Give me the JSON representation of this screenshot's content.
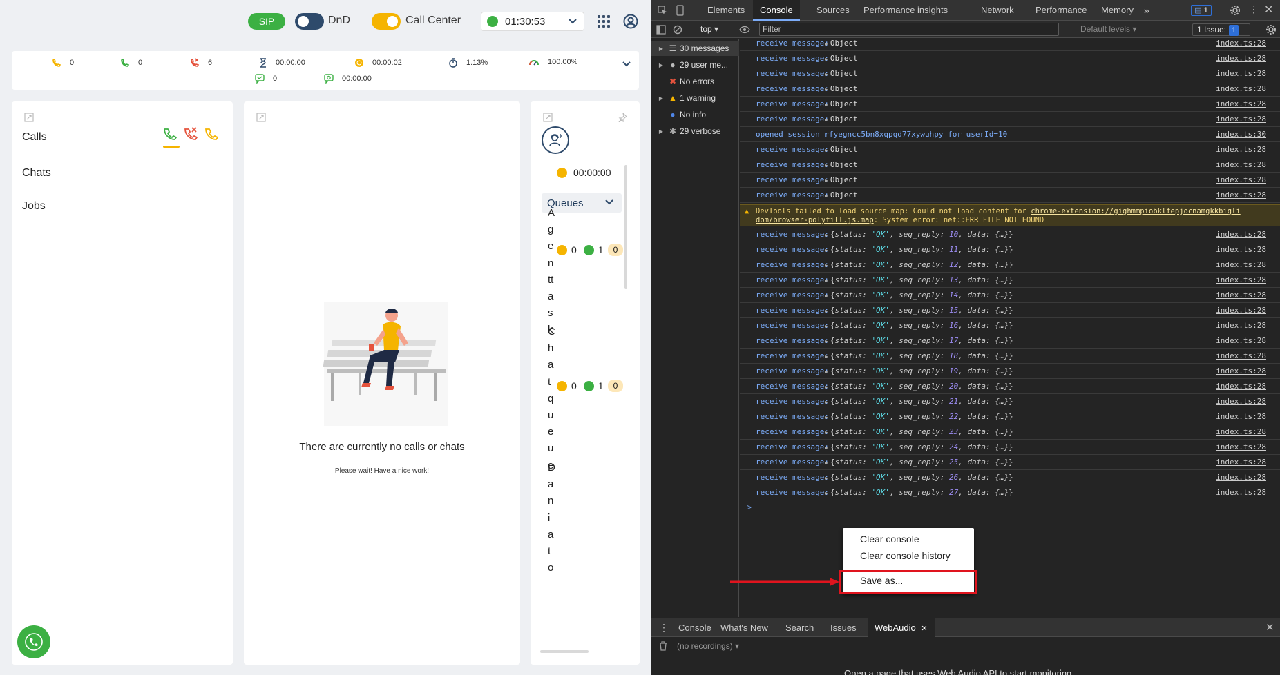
{
  "app": {
    "topbar": {
      "sip_label": "SIP",
      "dnd_label": "DnD",
      "call_center_label": "Call Center",
      "status_timer": "01:30:53"
    },
    "stats": [
      {
        "icon": "incoming-call-icon",
        "value": "0",
        "color": "#f5b400"
      },
      {
        "icon": "outgoing-call-icon",
        "value": "0",
        "color": "#3cb043"
      },
      {
        "icon": "missed-call-icon",
        "value": "6",
        "color": "#e5533d"
      },
      {
        "icon": "hourglass-icon",
        "value": "00:00:00",
        "color": "#2e4a6b"
      },
      {
        "icon": "coin-icon",
        "value": "00:00:02",
        "color": "#f5b400"
      },
      {
        "icon": "stopwatch-icon",
        "value": "1.13%",
        "color": "#2e4a6b"
      },
      {
        "icon": "gauge-icon",
        "value": "100.00%",
        "color": "#e5533d"
      },
      {
        "icon": "chat-check-icon",
        "value": "0",
        "color": "#3cb043"
      },
      {
        "icon": "chat-time-icon",
        "value": "00:00:00",
        "color": "#3cb043"
      }
    ],
    "nav": {
      "calls": "Calls",
      "chats": "Chats",
      "jobs": "Jobs"
    },
    "empty": {
      "title": "There are currently no calls or chats",
      "subtitle": "Please wait! Have a nice work!"
    },
    "right": {
      "timer": "00:00:00",
      "queues_label": "Queues",
      "queues": [
        {
          "name": "Agenttask",
          "yellow": "0",
          "green": "1",
          "badge": "0"
        },
        {
          "name": "Chatqueue",
          "yellow": "0",
          "green": "1",
          "badge": "0"
        },
        {
          "name": "Daniato",
          "yellow": "",
          "green": "",
          "badge": ""
        }
      ]
    },
    "colors": {
      "green": "#3cb043",
      "yellow": "#f5b400",
      "red": "#e5533d",
      "navy": "#2e4a6b"
    }
  },
  "devtools": {
    "tabs": [
      "Elements",
      "Console",
      "Sources",
      "Performance insights",
      "Network",
      "Performance",
      "Memory"
    ],
    "tab_badge": "1",
    "toolbar": {
      "context": "top",
      "filter_placeholder": "Filter",
      "levels": "Default levels",
      "issues": "1 Issue:",
      "issues_count": "1"
    },
    "sidebar": [
      {
        "label": "30 messages",
        "icon": "list-icon"
      },
      {
        "label": "29 user me...",
        "icon": "user-icon"
      },
      {
        "label": "No errors",
        "icon": "error-icon"
      },
      {
        "label": "1 warning",
        "icon": "warning-icon"
      },
      {
        "label": "No info",
        "icon": "info-icon"
      },
      {
        "label": "29 verbose",
        "icon": "bug-icon"
      }
    ],
    "log_prefix": "receive message:",
    "log_source": "index.ts:28",
    "object_label": "Object",
    "session_msg": "opened session rfyegncc5bn8xqpqd77xywuhpy for userId=10",
    "session_source": "index.ts:30",
    "warning": {
      "prefix": "DevTools failed to load source map: Could not load content for ",
      "link1": "chrome-extension://gighmmpiobklfepjocnamgkkbigli",
      "link2": "dom/browser-polyfill.js.map",
      "suffix": ": System error: net::ERR_FILE_NOT_FOUND"
    },
    "status_value": "'OK'",
    "data_value": "{…}",
    "seq_replies": [
      "10",
      "11",
      "12",
      "13",
      "14",
      "15",
      "16",
      "17",
      "18",
      "19",
      "20",
      "21",
      "22",
      "23",
      "24",
      "25",
      "26",
      "27"
    ],
    "prompt": ">",
    "context_menu": {
      "clear_console": "Clear console",
      "clear_history": "Clear console history",
      "save_as": "Save as..."
    },
    "drawer": {
      "tabs": [
        "Console",
        "What's New",
        "Search",
        "Issues",
        "WebAudio"
      ],
      "recordings": "(no recordings)",
      "hint": "Open a page that uses Web Audio API to start monitoring."
    }
  }
}
